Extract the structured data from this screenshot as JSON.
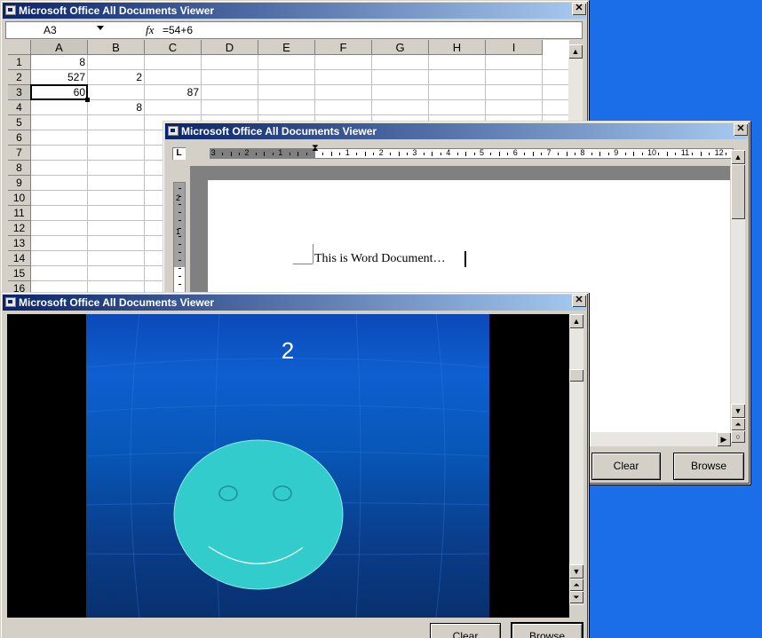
{
  "colors": {
    "desktop": "#1b6ee8",
    "titlebar_start": "#0a246a",
    "titlebar_end": "#a6caf0",
    "window_face": "#d4d0c8",
    "smiley": "#33cccc"
  },
  "excel": {
    "title": "Microsoft Office All Documents Viewer",
    "name_box": "A3",
    "fx_label": "fx",
    "formula": "=54+6",
    "columns": [
      "A",
      "B",
      "C",
      "D",
      "E",
      "F",
      "G",
      "H",
      "I"
    ],
    "rows": [
      "1",
      "2",
      "3",
      "4",
      "5",
      "6",
      "7",
      "8",
      "9",
      "10",
      "11",
      "12",
      "13",
      "14",
      "15",
      "16"
    ],
    "cells": {
      "A1": "8",
      "A2": "527",
      "B2": "2",
      "A3": "60",
      "C3": "87",
      "B4": "8"
    }
  },
  "word": {
    "title": "Microsoft Office All Documents Viewer",
    "tab_selector": "L",
    "ruler_left_numbers": [
      "3",
      "2",
      "1"
    ],
    "ruler_right_numbers": [
      "1",
      "2",
      "3",
      "4",
      "5",
      "6",
      "7",
      "8",
      "9",
      "10",
      "11",
      "12"
    ],
    "vertical_ruler_numbers": [
      "2",
      "1"
    ],
    "text": "This is Word Document…",
    "clear_label": "Clear",
    "browse_label": "Browse"
  },
  "powerpoint": {
    "title": "Microsoft Office All Documents Viewer",
    "slide_number": "2",
    "clear_label": "Clear",
    "browse_label": "Browse"
  }
}
